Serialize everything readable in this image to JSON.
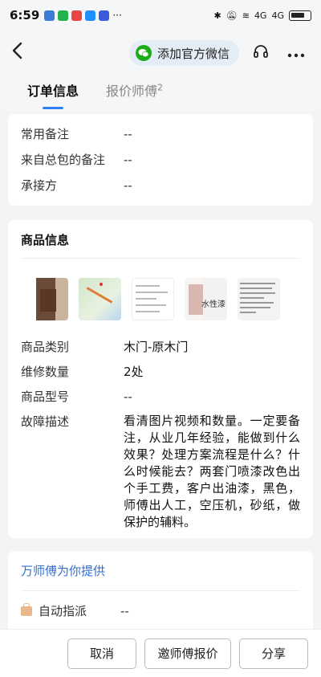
{
  "status_bar": {
    "time": "6:59",
    "app_icons": [
      "#3d7bd9",
      "#22b14c",
      "#e84545",
      "#1e90ff",
      "#3b5bdb"
    ],
    "more": "···",
    "network": "4G",
    "network2": "4G"
  },
  "nav": {
    "back_icon": "chevron-left-icon",
    "wechat_label": "添加官方微信",
    "headset_icon": "headset-icon",
    "more_icon": "more-icon"
  },
  "tabs": [
    {
      "label": "订单信息",
      "active": true
    },
    {
      "label": "报价师傅",
      "badge": "2",
      "active": false
    }
  ],
  "order_info": {
    "rows": [
      {
        "label": "常用备注",
        "value": "--"
      },
      {
        "label": "来自总包的备注",
        "value": "--"
      },
      {
        "label": "承接方",
        "value": "--"
      }
    ]
  },
  "product_info": {
    "title": "商品信息",
    "thumbnail_text": "水性漆",
    "rows": [
      {
        "label": "商品类别",
        "value": "木门-原木门"
      },
      {
        "label": "维修数量",
        "value": "2处"
      },
      {
        "label": "商品型号",
        "value": "--"
      },
      {
        "label": "故障描述",
        "value": "看清图片视频和数量。一定要备注，从业几年经验，能做到什么效果？处理方案流程是什么？什么时候能去？两套门喷漆改色出个手工费，客户出油漆，黑色，师傅出人工，空压机，砂纸，做保护的辅料。"
      }
    ]
  },
  "provider": {
    "title": "万师傅为你提供",
    "auto_label": "自动指派",
    "auto_value": "--"
  },
  "bottom": {
    "cancel": "取消",
    "invite": "邀师傅报价",
    "share": "分享"
  },
  "colors": {
    "accent": "#2d7ff9",
    "provider_title": "#2f6fd6",
    "wechat_green": "#1aad19"
  }
}
